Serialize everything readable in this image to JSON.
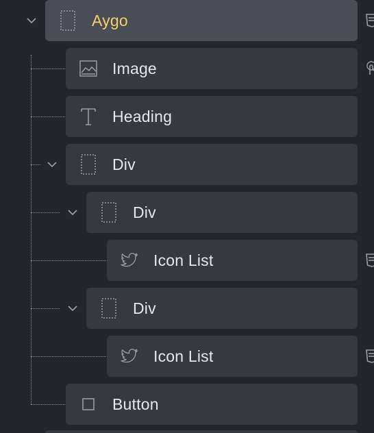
{
  "navigator": {
    "items": [
      {
        "label": "Aygo",
        "icon": "div-icon",
        "expanded": true,
        "active": true
      },
      {
        "label": "Image",
        "icon": "image-icon"
      },
      {
        "label": "Heading",
        "icon": "heading-icon"
      },
      {
        "label": "Div",
        "icon": "div-icon",
        "expanded": true
      },
      {
        "label": "Div",
        "icon": "div-icon",
        "expanded": true
      },
      {
        "label": "Icon List",
        "icon": "twitter-icon"
      },
      {
        "label": "Div",
        "icon": "div-icon",
        "expanded": true
      },
      {
        "label": "Icon List",
        "icon": "twitter-icon"
      },
      {
        "label": "Button",
        "icon": "button-icon"
      }
    ]
  },
  "colors": {
    "background": "#23262b",
    "row": "#363940",
    "row_active": "#4a4d55",
    "active_text": "#f2d16b",
    "text": "#e6e7ea",
    "icon": "#9a9da4"
  }
}
